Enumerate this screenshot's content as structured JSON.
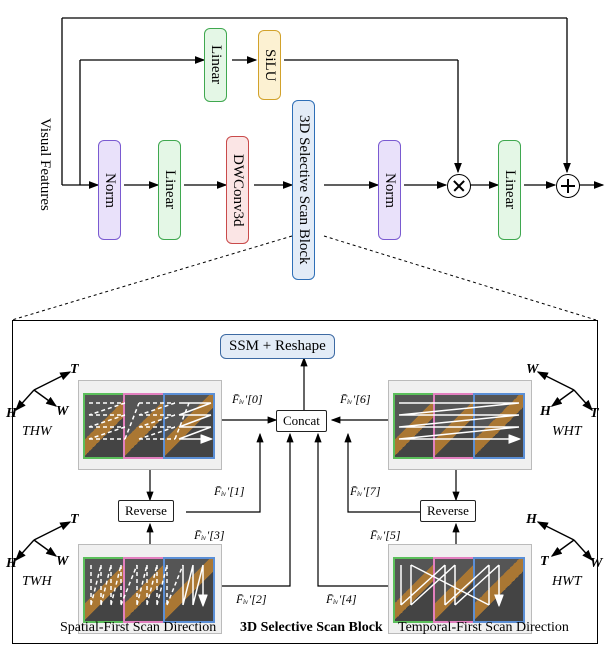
{
  "top": {
    "input": "Visual Features",
    "norm1": "Norm",
    "linear1": "Linear",
    "dwconv": "DWConv3d",
    "scan": "3D Selective Scan Block",
    "norm2": "Norm",
    "linear_top": "Linear",
    "silu": "SiLU",
    "linear_out": "Linear"
  },
  "bottom": {
    "ssm": "SSM + Reshape",
    "concat": "Concat",
    "reverse_l": "Reverse",
    "reverse_r": "Reverse",
    "title": "3D Selective Scan Block",
    "spatial": "Spatial-First Scan Direction",
    "temporal": "Temporal-First Scan Direction",
    "axes": {
      "tl": {
        "order": "THW",
        "T": "T",
        "H": "H",
        "W": "W"
      },
      "bl": {
        "order": "TWH",
        "T": "T",
        "H": "H",
        "W": "W"
      },
      "tr": {
        "order": "WHT",
        "T": "T",
        "H": "H",
        "W": "W"
      },
      "br": {
        "order": "HWT",
        "T": "T",
        "H": "H",
        "W": "W"
      }
    },
    "feat": {
      "f0": "F̄ᵢᵥ′[0]",
      "f1": "F̄ᵢᵥ′[1]",
      "f2": "F̄ᵢᵥ′[2]",
      "f3": "F̄ᵢᵥ′[3]",
      "f4": "F̄ᵢᵥ′[4]",
      "f5": "F̄ᵢᵥ′[5]",
      "f6": "F̄ᵢᵥ′[6]",
      "f7": "F̄ᵢᵥ′[7]"
    }
  },
  "chart_data": {
    "type": "diagram",
    "note": "Architecture diagram, no numeric data series",
    "top_pipeline_main": [
      "Visual Features",
      "Norm",
      "Linear",
      "DWConv3d",
      "3D Selective Scan Block",
      "Norm",
      "⊗",
      "Linear",
      "⊕",
      "out"
    ],
    "top_pipeline_gate": [
      "Visual Features",
      "Linear",
      "SiLU",
      "⊗"
    ],
    "residual": [
      "Visual Features",
      "⊕"
    ],
    "scan_block": {
      "spatial_first": {
        "orders": [
          "THW",
          "TWH"
        ],
        "outputs": [
          "F̄ᵢᵥ′[0]",
          "F̄ᵢᵥ′[1]",
          "F̄ᵢᵥ′[2]",
          "F̄ᵢᵥ′[3]"
        ],
        "reverse_pairs": [
          [
            "F̄ᵢᵥ′[0]",
            "F̄ᵢᵥ′[1]"
          ],
          [
            "F̄ᵢᵥ′[2]",
            "F̄ᵢᵥ′[3]"
          ]
        ]
      },
      "temporal_first": {
        "orders": [
          "WHT",
          "HWT"
        ],
        "outputs": [
          "F̄ᵢᵥ′[4]",
          "F̄ᵢᵥ′[5]",
          "F̄ᵢᵥ′[6]",
          "F̄ᵢᵥ′[7]"
        ],
        "reverse_pairs": [
          [
            "F̄ᵢᵥ′[6]",
            "F̄ᵢᵥ′[7]"
          ],
          [
            "F̄ᵢᵥ′[4]",
            "F̄ᵢᵥ′[5]"
          ]
        ]
      },
      "merge": "Concat → SSM + Reshape"
    }
  }
}
